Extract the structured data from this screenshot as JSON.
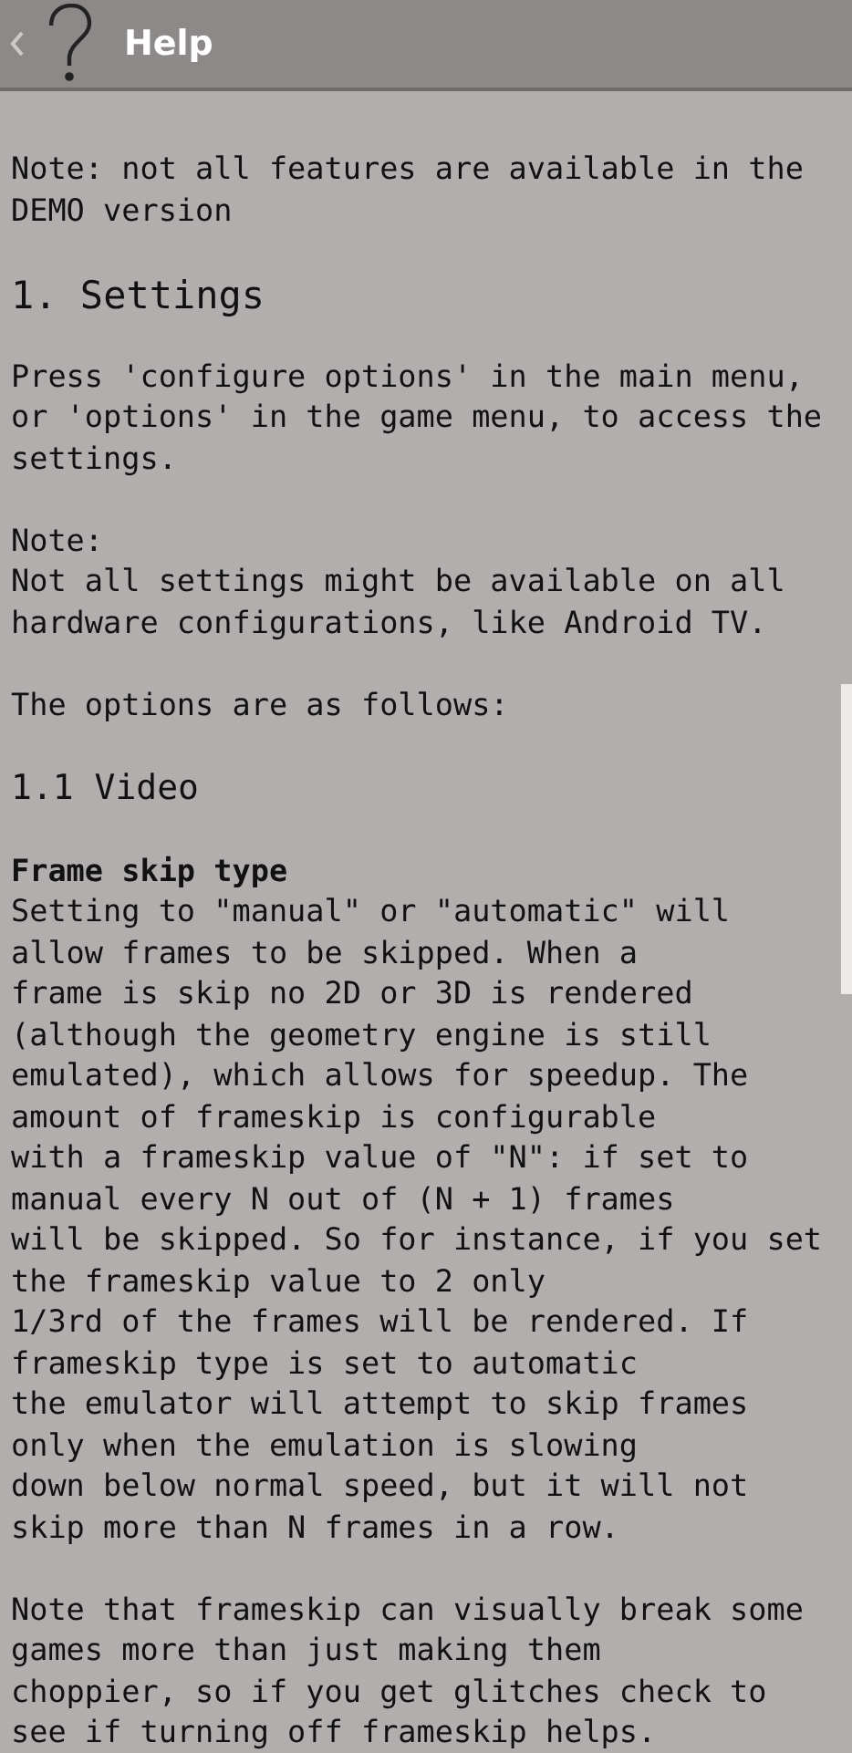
{
  "app_bar": {
    "title": "Help"
  },
  "content": [
    {
      "kind": "paragraph",
      "text": "Note: not all features are available in the\nDEMO version"
    },
    {
      "kind": "heading",
      "text": "1. Settings"
    },
    {
      "kind": "paragraph",
      "text": "Press 'configure options' in the main menu,\nor 'options' in the game menu, to access the\nsettings."
    },
    {
      "kind": "paragraph",
      "text": "Note:\nNot all settings might be available on all\nhardware configurations, like Android TV."
    },
    {
      "kind": "paragraph",
      "text": "The options are as follows:"
    },
    {
      "kind": "subheading",
      "text": "1.1 Video"
    },
    {
      "kind": "term",
      "text": "Frame skip type"
    },
    {
      "kind": "paragraph",
      "text": "Setting to \"manual\" or \"automatic\" will\nallow frames to be skipped. When a\nframe is skip no 2D or 3D is rendered\n(although the geometry engine is still\nemulated), which allows for speedup. The\namount of frameskip is configurable\nwith a frameskip value of \"N\": if set to\nmanual every N out of (N + 1) frames\nwill be skipped. So for instance, if you set\nthe frameskip value to 2 only\n1/3rd of the frames will be rendered. If\nframeskip type is set to automatic\nthe emulator will attempt to skip frames\nonly when the emulation is slowing\ndown below normal speed, but it will not\nskip more than N frames in a row."
    },
    {
      "kind": "paragraph",
      "text": "Note that frameskip can visually break some\ngames more than just making them\nchoppier, so if you get glitches check to\nsee if turning off frameskip helps."
    }
  ]
}
